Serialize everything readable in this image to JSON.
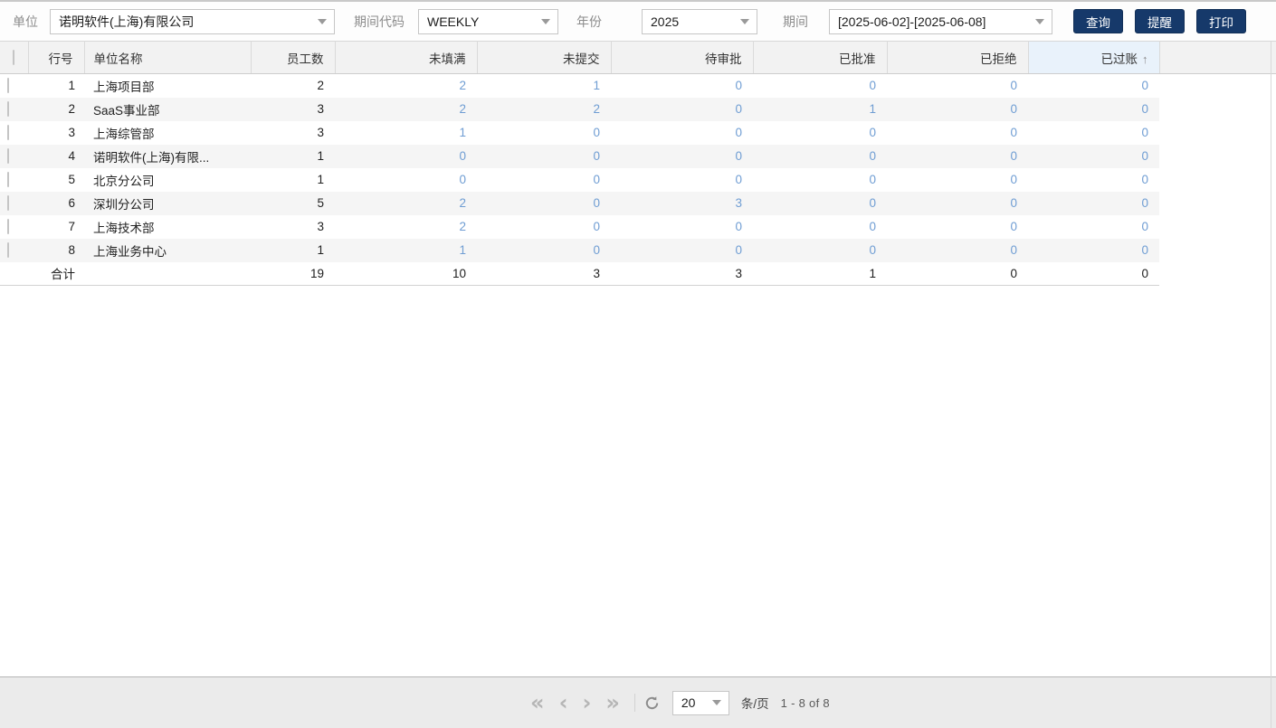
{
  "toolbar": {
    "unit_label": "单位",
    "unit_value": "诺明软件(上海)有限公司",
    "period_code_label": "期间代码",
    "period_code_value": "WEEKLY",
    "year_label": "年份",
    "year_value": "2025",
    "period_label": "期间",
    "period_value": "[2025-06-02]-[2025-06-08]",
    "query_button": "查询",
    "remind_button": "提醒",
    "print_button": "打印"
  },
  "table": {
    "columns": {
      "row_no": "行号",
      "unit_name": "单位名称",
      "employees": "员工数",
      "unfilled": "未填满",
      "unsubmitted": "未提交",
      "pending_approval": "待审批",
      "approved": "已批准",
      "rejected": "已拒绝",
      "posted": "已过账"
    },
    "sort": {
      "column": "已过账",
      "direction_arrow": "↑"
    },
    "rows": [
      {
        "no": "1",
        "name": "上海项目部",
        "employees": "2",
        "unfilled": "2",
        "unsubmitted": "1",
        "pending": "0",
        "approved": "0",
        "rejected": "0",
        "posted": "0"
      },
      {
        "no": "2",
        "name": "SaaS事业部",
        "employees": "3",
        "unfilled": "2",
        "unsubmitted": "2",
        "pending": "0",
        "approved": "1",
        "rejected": "0",
        "posted": "0"
      },
      {
        "no": "3",
        "name": "上海综管部",
        "employees": "3",
        "unfilled": "1",
        "unsubmitted": "0",
        "pending": "0",
        "approved": "0",
        "rejected": "0",
        "posted": "0"
      },
      {
        "no": "4",
        "name": "诺明软件(上海)有限...",
        "employees": "1",
        "unfilled": "0",
        "unsubmitted": "0",
        "pending": "0",
        "approved": "0",
        "rejected": "0",
        "posted": "0"
      },
      {
        "no": "5",
        "name": "北京分公司",
        "employees": "1",
        "unfilled": "0",
        "unsubmitted": "0",
        "pending": "0",
        "approved": "0",
        "rejected": "0",
        "posted": "0"
      },
      {
        "no": "6",
        "name": "深圳分公司",
        "employees": "5",
        "unfilled": "2",
        "unsubmitted": "0",
        "pending": "3",
        "approved": "0",
        "rejected": "0",
        "posted": "0"
      },
      {
        "no": "7",
        "name": "上海技术部",
        "employees": "3",
        "unfilled": "2",
        "unsubmitted": "0",
        "pending": "0",
        "approved": "0",
        "rejected": "0",
        "posted": "0"
      },
      {
        "no": "8",
        "name": "上海业务中心",
        "employees": "1",
        "unfilled": "1",
        "unsubmitted": "0",
        "pending": "0",
        "approved": "0",
        "rejected": "0",
        "posted": "0"
      }
    ],
    "total": {
      "label": "合计",
      "employees": "19",
      "unfilled": "10",
      "unsubmitted": "3",
      "pending": "3",
      "approved": "1",
      "rejected": "0",
      "posted": "0"
    }
  },
  "pagination": {
    "first_icon": "«",
    "prev_icon": "‹",
    "next_icon": "›",
    "last_icon": "»",
    "page_size": "20",
    "page_size_label": "条/页",
    "range_text": "1 - 8 of 8"
  },
  "colors": {
    "button_bg": "#16396a",
    "link_blue": "#6f9dd3",
    "sorted_header_bg": "#e9f2fb",
    "stripe_bg": "#f5f5f5",
    "pager_bg": "#ebebeb"
  }
}
